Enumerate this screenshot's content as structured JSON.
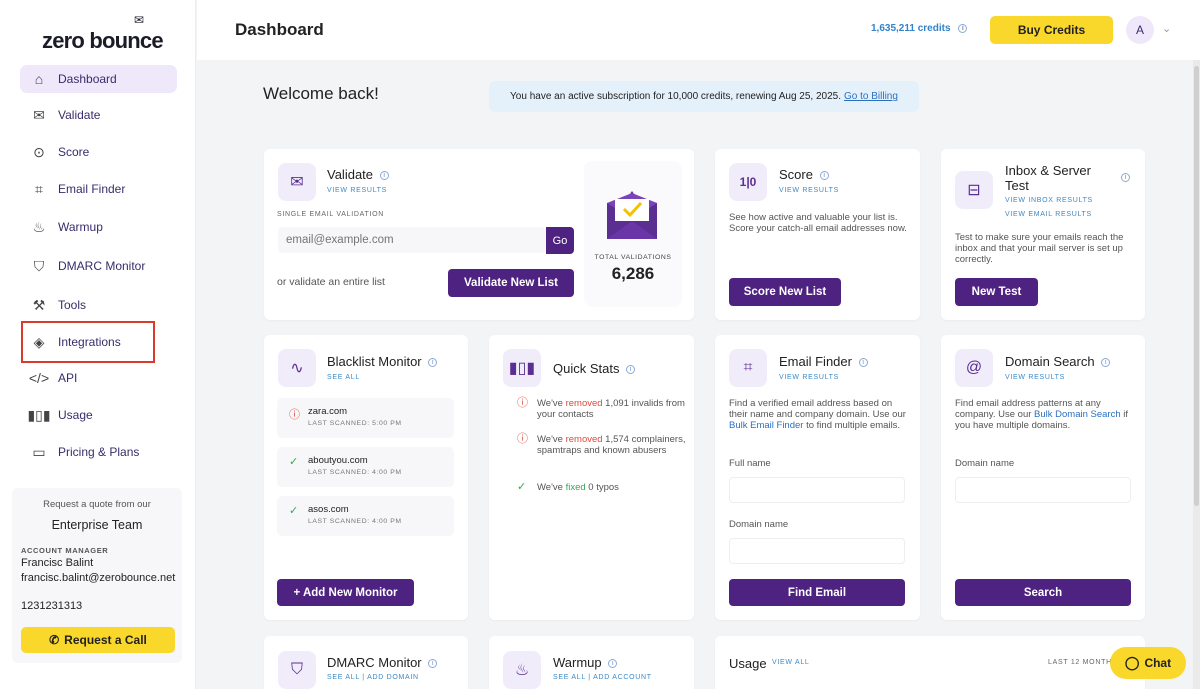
{
  "brand": {
    "logo_text": "zero bounce"
  },
  "sidebar": {
    "items": [
      {
        "label": "Dashboard",
        "icon": "home-icon"
      },
      {
        "label": "Validate",
        "icon": "envelope-icon"
      },
      {
        "label": "Score",
        "icon": "score-icon"
      },
      {
        "label": "Email Finder",
        "icon": "finder-icon"
      },
      {
        "label": "Warmup",
        "icon": "flame-icon"
      },
      {
        "label": "DMARC Monitor",
        "icon": "shield-icon"
      },
      {
        "label": "Tools",
        "icon": "wrench-icon"
      },
      {
        "label": "Integrations",
        "icon": "layers-icon"
      },
      {
        "label": "API",
        "icon": "code-icon"
      },
      {
        "label": "Usage",
        "icon": "bar-chart-icon"
      },
      {
        "label": "Pricing & Plans",
        "icon": "card-icon"
      }
    ],
    "enterprise": {
      "quote": "Request a quote from our",
      "title": "Enterprise Team",
      "manager_label": "ACCOUNT MANAGER",
      "manager_name": "Francisc Balint",
      "manager_email": "francisc.balint@zerobounce.net",
      "manager_phone": "1231231313",
      "call_label": "Request a Call"
    }
  },
  "header": {
    "title": "Dashboard",
    "credits": "1,635,211 credits",
    "buy_label": "Buy Credits",
    "avatar_initial": "A"
  },
  "welcome": "Welcome back!",
  "banner": {
    "text": "You have an active subscription for 10,000 credits, renewing Aug 25, 2025.",
    "link": "Go to Billing"
  },
  "validate": {
    "title": "Validate",
    "sub": "VIEW RESULTS",
    "single_label": "SINGLE EMAIL VALIDATION",
    "email_placeholder": "email@example.com",
    "go_label": "Go",
    "list_text": "or validate an entire list",
    "list_button": "Validate New List",
    "total_label": "TOTAL VALIDATIONS",
    "total_value": "6,286"
  },
  "score": {
    "title": "Score",
    "sub": "VIEW RESULTS",
    "desc": "See how active and valuable your list is. Score your catch-all email addresses now.",
    "button": "Score New List"
  },
  "inbox": {
    "title": "Inbox & Server Test",
    "sub1": "VIEW INBOX RESULTS",
    "sub2": "VIEW EMAIL RESULTS",
    "desc": "Test to make sure your emails reach the inbox and that your mail server is set up correctly.",
    "button": "New Test"
  },
  "blacklist": {
    "title": "Blacklist Monitor",
    "sub": "SEE ALL",
    "items": [
      {
        "domain": "zara.com",
        "last": "LAST SCANNED: 5:00 PM",
        "status": "alert"
      },
      {
        "domain": "aboutyou.com",
        "last": "LAST SCANNED: 4:00 PM",
        "status": "ok"
      },
      {
        "domain": "asos.com",
        "last": "LAST SCANNED: 4:00 PM",
        "status": "ok"
      }
    ],
    "button": "+ Add New Monitor"
  },
  "quickstats": {
    "title": "Quick Stats",
    "stats": [
      {
        "pre": "We've ",
        "hl": "removed",
        "post": " 1,091 invalids from your contacts",
        "status": "alert"
      },
      {
        "pre": "We've ",
        "hl": "removed",
        "post": " 1,574 complainers, spamtraps and known abusers",
        "status": "alert"
      },
      {
        "pre": "We've ",
        "hl": "fixed",
        "post": " 0 typos",
        "status": "ok"
      }
    ]
  },
  "finder": {
    "title": "Email Finder",
    "sub": "VIEW RESULTS",
    "desc_pre": "Find a verified email address based on their name and company domain. Use our ",
    "desc_link": "Bulk Email Finder",
    "desc_post": " to find multiple emails.",
    "full_name_label": "Full name",
    "domain_label": "Domain name",
    "button": "Find Email"
  },
  "domainsearch": {
    "title": "Domain Search",
    "sub": "VIEW RESULTS",
    "desc_pre": "Find email address patterns at any company. Use our ",
    "desc_link": "Bulk Domain Search",
    "desc_post": " if you have multiple domains.",
    "domain_label": "Domain name",
    "button": "Search"
  },
  "dmarc": {
    "title": "DMARC Monitor",
    "sub": "SEE ALL | ADD DOMAIN"
  },
  "warmup": {
    "title": "Warmup",
    "sub": "SEE ALL | ADD ACCOUNT"
  },
  "usage": {
    "title": "Usage",
    "sub": "VIEW ALL",
    "range": "LAST 12 MONTHS"
  },
  "chat": {
    "label": "Chat"
  }
}
